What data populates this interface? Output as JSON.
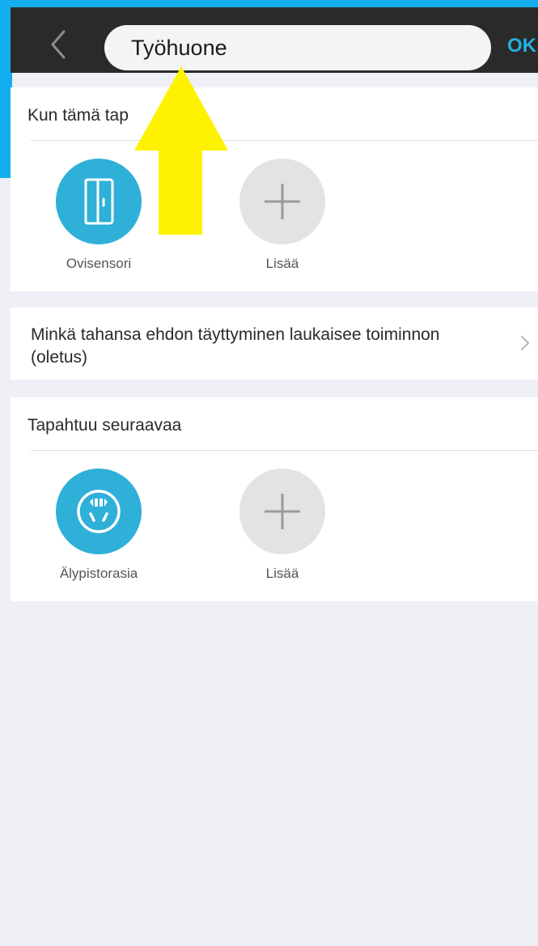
{
  "header": {
    "title_value": "Työhuone",
    "ok_label": "OK"
  },
  "trigger_section": {
    "title": "Kun tämä tap",
    "devices": [
      {
        "label": "Ovisensori",
        "icon": "door-sensor-icon"
      },
      {
        "label": "Lisää",
        "icon": "plus-icon"
      }
    ]
  },
  "condition_rule": {
    "text": "Minkä tahansa ehdon täyttyminen laukaisee toiminnon (oletus)"
  },
  "action_section": {
    "title": "Tapahtuu seuraavaa",
    "devices": [
      {
        "label": "Älypistorasia",
        "icon": "smart-plug-icon"
      },
      {
        "label": "Lisää",
        "icon": "plus-icon"
      }
    ]
  },
  "colors": {
    "accent": "#2eb0d8",
    "header_bg": "#2a2a2a",
    "frame_cyan": "#13aeed",
    "annotation_arrow": "#fef200",
    "page_bg": "#efeff6"
  }
}
